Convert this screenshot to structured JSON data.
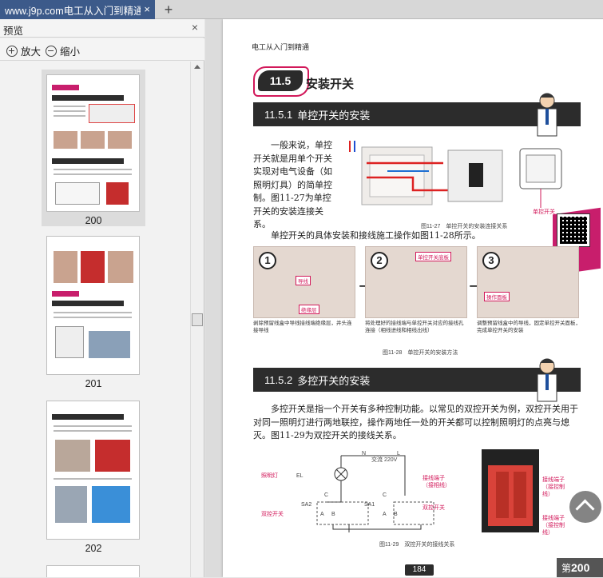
{
  "browser": {
    "tab_title": "www.j9p.com电工从入门到精通",
    "close_glyph": "×",
    "new_tab_glyph": "+"
  },
  "preview_panel": {
    "title": "预览",
    "close_glyph": "×",
    "zoom_in_label": "放大",
    "zoom_out_label": "缩小",
    "thumbnails": [
      {
        "page": "200",
        "selected": true
      },
      {
        "page": "201",
        "selected": false
      },
      {
        "page": "202",
        "selected": false
      }
    ]
  },
  "document": {
    "running_head": "电工从入门到精通",
    "section_number": "11.5",
    "section_title": "安装开关",
    "sub1": {
      "number": "11.5.1",
      "title": "单控开关的安装"
    },
    "para1": "一般来说，单控开关就是用单个开关实现对电气设备（如照明灯具）的简单控制。图11-27为单控开关的安装连接关系。",
    "fig27_caption": "图11-27　单控开关的安装连接关系",
    "fig27_label": "单控开关",
    "para2": "单控开关的具体安装和接线施工操作如图11-28所示。",
    "steps": [
      {
        "num": "1",
        "caption": "剥除预留线盒中导线接线端绝缘层，并头连接导线",
        "tags": [
          "导线",
          "绝缘层"
        ]
      },
      {
        "num": "2",
        "caption": "将处理好的接线端与单控开关对应的接线孔连接（相线进线和相线出线）",
        "tags": [
          "单控开关底板"
        ]
      },
      {
        "num": "3",
        "caption": "调整预留线盒中的导线，固定单控开关面板，完成单控开关的安装",
        "tags": [
          "操作面板"
        ]
      }
    ],
    "arrow_glyph": "→",
    "fig28_caption": "图11-28　单控开关的安装方法",
    "sub2": {
      "number": "11.5.2",
      "title": "多控开关的安装"
    },
    "para3": "多控开关是指一个开关有多种控制功能。以常见的双控开关为例，双控开关用于对同一照明灯进行两地联控，操作两地任一处的开关都可以控制照明灯的点亮与熄灭。图11-29为双控开关的接线关系。",
    "fig29": {
      "n_label": "N",
      "l_label": "L",
      "voltage": "交流 220V",
      "lamp_label": "照明灯",
      "el": "EL",
      "sa2": "SA2",
      "sa1": "SA1",
      "switch_label_left": "双控开关",
      "switch_label_right": "双控开关",
      "c": "C",
      "a": "A",
      "b": "B",
      "terminal1": "接线端子（接相线）",
      "terminal2": "接线端子（接控制线）",
      "terminal3": "接线端子（接控制线）"
    },
    "fig29_caption": "图11-29　双控开关的接线关系",
    "footer_page": "184"
  },
  "page_indicator": {
    "prefix": "第",
    "number": "200"
  }
}
